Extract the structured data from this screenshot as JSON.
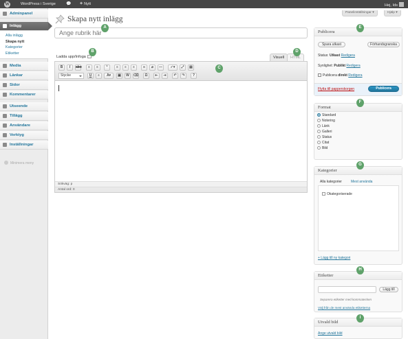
{
  "adminbar": {
    "site_name": "WordPress i Sverige",
    "new_label": "Nytt",
    "howdy": "Hej, Ids"
  },
  "sidebar": {
    "items": [
      {
        "label": "Adminpanel"
      },
      {
        "label": "Inlägg"
      },
      {
        "label": "Media"
      },
      {
        "label": "Länkar"
      },
      {
        "label": "Sidor"
      },
      {
        "label": "Kommentarer"
      },
      {
        "label": "Utseende"
      },
      {
        "label": "Tillägg"
      },
      {
        "label": "Användare"
      },
      {
        "label": "Verktyg"
      },
      {
        "label": "Inställningar"
      }
    ],
    "submenu": [
      "Alla inlägg",
      "Skapa nytt",
      "Kategorier",
      "Etiketter"
    ],
    "collapse": "Minimera meny"
  },
  "top_buttons": {
    "screen_options": "Panelinställningar ▾",
    "help": "Hjälp ▾"
  },
  "page": {
    "title": "Skapa nytt inlägg",
    "title_placeholder": "Ange rubrik här"
  },
  "markers": [
    "A",
    "B",
    "C",
    "D",
    "E",
    "F",
    "G",
    "H",
    "I"
  ],
  "editor": {
    "upload_label": "Ladda upp/Infoga",
    "tab_visual": "Visuell",
    "tab_html": "HTML",
    "style_select": "Stycke",
    "path": "Sökväg: p",
    "word_count": "Antal ord: 0"
  },
  "publish": {
    "title": "Publicera",
    "save_draft": "Spara utkast",
    "preview": "Förhandsgranska",
    "status_label": "Status:",
    "status_value": "Utkast",
    "visibility_label": "Synlighet:",
    "visibility_value": "Publikt",
    "publish_when": "Publicera",
    "publish_when_value": "direkt",
    "edit": "Redigera",
    "trash": "Flytta till papperskorgen",
    "publish_btn": "Publicera"
  },
  "format": {
    "title": "Format",
    "options": [
      "Standard",
      "Notering",
      "Länk",
      "Galleri",
      "Status",
      "Citat",
      "Bild"
    ],
    "selected": "Standard"
  },
  "categories": {
    "title": "Kategorier",
    "tab_all": "Alla kategorier",
    "tab_popular": "Mest använda",
    "items": [
      "Okategoriserade"
    ],
    "add_link": "+ Lägg till ny kategori"
  },
  "tags": {
    "title": "Etiketter",
    "add_btn": "Lägg till",
    "hint": "Separera etiketter med kommatecken",
    "choose_link": "Välj från de mest använda etiketterna"
  },
  "featured": {
    "title": "Utvald bild",
    "link": "Ange utvald bild"
  },
  "colors": {
    "link": "#21759b",
    "marker": "#5fa26a",
    "trash": "#bc0b0b"
  }
}
